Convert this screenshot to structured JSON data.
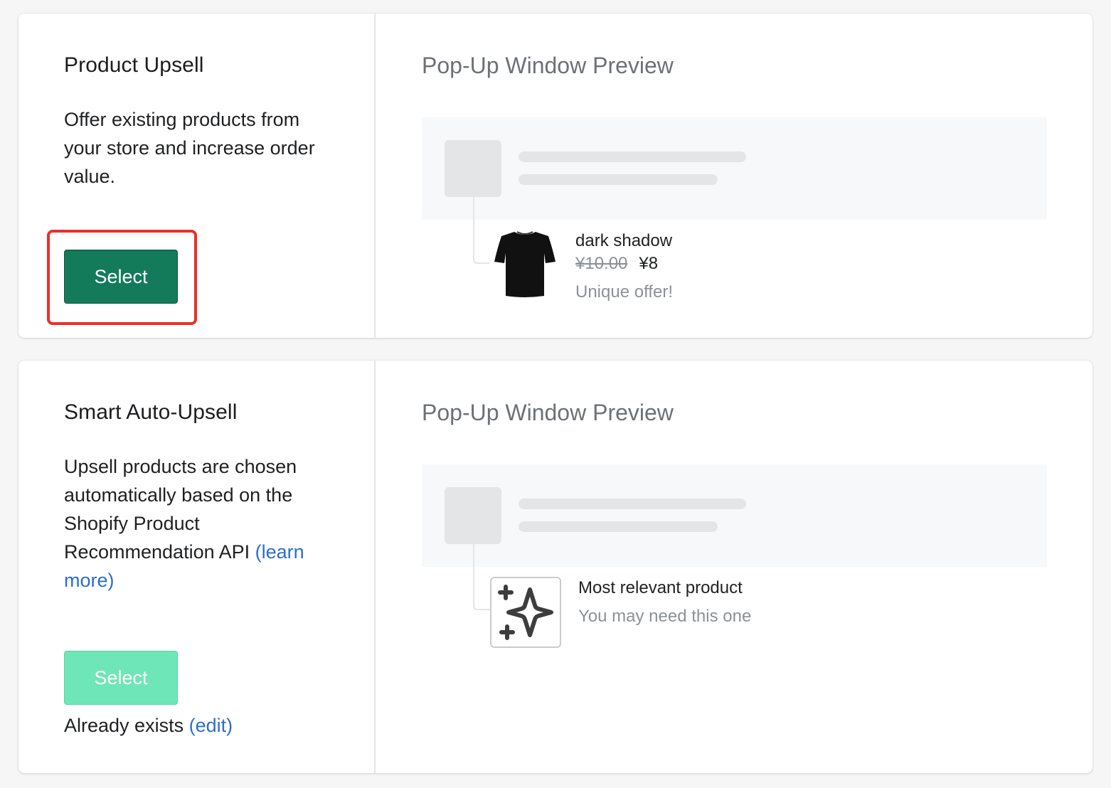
{
  "cards": [
    {
      "title": "Product Upsell",
      "description": "Offer existing products from your store and increase order value.",
      "button_label": "Select",
      "button_state": "enabled",
      "button_color": "#137b59",
      "highlighted": true,
      "preview": {
        "title": "Pop-Up Window Preview",
        "product_name": "dark shadow",
        "old_price": "¥10.00",
        "new_price": "¥8",
        "subtitle": "Unique offer!",
        "image_icon": "black-tshirt-icon"
      }
    },
    {
      "title": "Smart Auto-Upsell",
      "description": "Upsell products are chosen automatically based on the Shopify Product Recommendation API ",
      "learn_more": "(learn more)",
      "button_label": "Select",
      "button_state": "disabled",
      "button_color": "#6fe6b7",
      "status_text": "Already exists ",
      "edit_link": "(edit)",
      "preview": {
        "title": "Pop-Up Window Preview",
        "product_name": "Most relevant product",
        "subtitle": "You may need this one",
        "image_icon": "sparkles-icon"
      }
    }
  ],
  "colors": {
    "link": "#2c6ecb",
    "highlight": "#e8312a"
  }
}
